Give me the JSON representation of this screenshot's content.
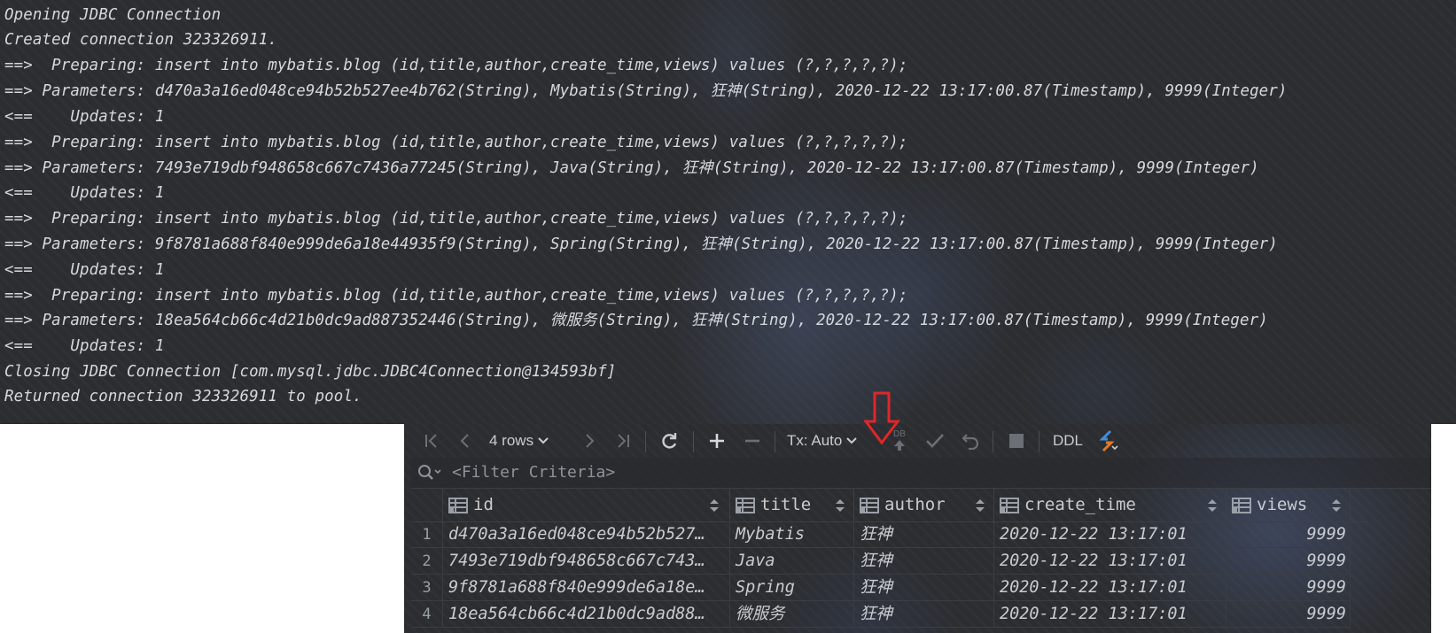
{
  "console": {
    "lines": [
      "Opening JDBC Connection",
      "Created connection 323326911.",
      "==>  Preparing: insert into mybatis.blog (id,title,author,create_time,views) values (?,?,?,?,?);",
      "==> Parameters: d470a3a16ed048ce94b52b527ee4b762(String), Mybatis(String), 狂神(String), 2020-12-22 13:17:00.87(Timestamp), 9999(Integer)",
      "<==    Updates: 1",
      "==>  Preparing: insert into mybatis.blog (id,title,author,create_time,views) values (?,?,?,?,?);",
      "==> Parameters: 7493e719dbf948658c667c7436a77245(String), Java(String), 狂神(String), 2020-12-22 13:17:00.87(Timestamp), 9999(Integer)",
      "<==    Updates: 1",
      "==>  Preparing: insert into mybatis.blog (id,title,author,create_time,views) values (?,?,?,?,?);",
      "==> Parameters: 9f8781a688f840e999de6a18e44935f9(String), Spring(String), 狂神(String), 2020-12-22 13:17:00.87(Timestamp), 9999(Integer)",
      "<==    Updates: 1",
      "==>  Preparing: insert into mybatis.blog (id,title,author,create_time,views) values (?,?,?,?,?);",
      "==> Parameters: 18ea564cb66c4d21b0dc9ad887352446(String), 微服务(String), 狂神(String), 2020-12-22 13:17:00.87(Timestamp), 9999(Integer)",
      "<==    Updates: 1",
      "Closing JDBC Connection [com.mysql.jdbc.JDBC4Connection@134593bf]",
      "Returned connection 323326911 to pool."
    ]
  },
  "toolbar": {
    "rows_label": "4 rows",
    "tx_label": "Tx: Auto",
    "db_label": "DB",
    "ddl_label": "DDL",
    "icons": [
      "first-page-icon",
      "prev-page-icon",
      "rows-dropdown-icon",
      "next-page-icon",
      "last-page-icon",
      "refresh-icon",
      "add-row-icon",
      "delete-row-icon",
      "tx-dropdown-icon",
      "submit-icon",
      "commit-icon",
      "rollback-icon",
      "stop-icon",
      "compare-icon"
    ]
  },
  "filter": {
    "placeholder": "<Filter Criteria>"
  },
  "table": {
    "columns": [
      "id",
      "title",
      "author",
      "create_time",
      "views"
    ],
    "rows": [
      {
        "num": "1",
        "id": "d470a3a16ed048ce94b52b527…",
        "title": "Mybatis",
        "author": "狂神",
        "create_time": "2020-12-22 13:17:01",
        "views": "9999"
      },
      {
        "num": "2",
        "id": "7493e719dbf948658c667c743…",
        "title": "Java",
        "author": "狂神",
        "create_time": "2020-12-22 13:17:01",
        "views": "9999"
      },
      {
        "num": "3",
        "id": "9f8781a688f840e999de6a18e…",
        "title": "Spring",
        "author": "狂神",
        "create_time": "2020-12-22 13:17:01",
        "views": "9999"
      },
      {
        "num": "4",
        "id": "18ea564cb66c4d21b0dc9ad88…",
        "title": "微服务",
        "author": "狂神",
        "create_time": "2020-12-22 13:17:01",
        "views": "9999"
      }
    ]
  },
  "colors": {
    "background": "#2b2d30",
    "text": "#d5d8de",
    "arrow": "#e0262a",
    "accent_blue": "#3d8fe0",
    "accent_orange": "#e07b2a"
  }
}
